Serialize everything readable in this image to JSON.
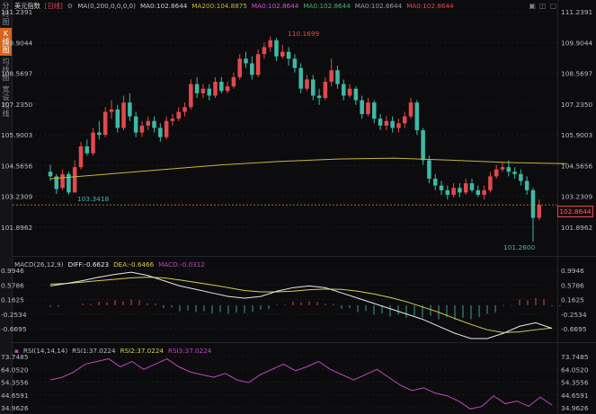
{
  "toolbar": {
    "tabs": [
      {
        "label": "分时图",
        "active": false
      },
      {
        "label": "K线图",
        "active": true
      },
      {
        "label": "均线图",
        "active": false
      },
      {
        "label": "宽设均线",
        "active": false
      }
    ]
  },
  "main_legend": {
    "symbol": "美元指数",
    "period": "[日线]",
    "ma_params": "MA(0,200,0,0,0,0)",
    "ma0": "MA0:102.8644",
    "ma200": "MA200:104.8875",
    "ma0b": "MA0:102.8644",
    "ma0c": "MA0:102.8644",
    "ma0d": "MA0:102.8644",
    "ma0e": "MA0:102.8644"
  },
  "macd_legend": {
    "name": "MACD(26,12,9)",
    "diff": "DIFF:-0.6623",
    "dea": "DEA:-0.6466",
    "macd": "MACD:-0.0312"
  },
  "rsi_legend": {
    "name": "RSI(14,14,14)",
    "rsi1": "RSI1:37.0224",
    "rsi2": "RSI2:37.0224",
    "rsi3": "RSI3:37.0224"
  },
  "colors": {
    "up": "#e2494c",
    "down": "#3fb8a4",
    "ma200": "#c9b53a",
    "dea": "#d7ce52",
    "diff": "#e8e8e8",
    "rsi": "#c046c8",
    "macd_pos": "#d94a4d",
    "macd_neg": "#3a9f8f",
    "price_line": "#e08a2a"
  },
  "icons": [
    "settings-icon",
    "refresh-icon",
    "close-icon"
  ],
  "chart_data": [
    {
      "type": "candlestick",
      "title": "美元指数 [日线]",
      "yaxis_ticks": [
        "111.2391",
        "109.9044",
        "108.5697",
        "107.2350",
        "105.9003",
        "104.5656",
        "103.2309",
        "101.8962"
      ],
      "ylim": [
        101.4,
        111.2391
      ],
      "last_price": "102.8644",
      "high_label": "110.1699",
      "low_label_1": "103.3418",
      "low_label_2": "101.2600",
      "candles": [
        [
          104.3,
          104.1,
          104.6,
          103.9
        ],
        [
          104.1,
          103.55,
          104.2,
          103.34
        ],
        [
          103.6,
          104.2,
          104.4,
          103.5
        ],
        [
          104.2,
          103.4,
          104.3,
          103.3
        ],
        [
          103.4,
          104.5,
          104.8,
          103.4
        ],
        [
          104.5,
          105.4,
          105.6,
          104.4
        ],
        [
          105.4,
          105.1,
          105.7,
          105.0
        ],
        [
          105.1,
          106.0,
          106.2,
          105.0
        ],
        [
          106.0,
          105.9,
          106.5,
          105.7
        ],
        [
          105.9,
          106.9,
          107.1,
          105.8
        ],
        [
          106.9,
          107.0,
          107.4,
          106.6
        ],
        [
          107.0,
          106.2,
          107.2,
          106.0
        ],
        [
          106.2,
          107.3,
          107.6,
          106.1
        ],
        [
          107.3,
          106.7,
          107.7,
          106.5
        ],
        [
          106.7,
          106.0,
          106.9,
          105.8
        ],
        [
          106.0,
          106.3,
          106.5,
          105.8
        ],
        [
          106.3,
          106.5,
          106.7,
          106.1
        ],
        [
          106.5,
          106.2,
          106.7,
          106.0
        ],
        [
          106.2,
          105.8,
          106.4,
          105.6
        ],
        [
          105.8,
          106.5,
          106.7,
          105.7
        ],
        [
          106.5,
          106.6,
          106.8,
          106.3
        ],
        [
          106.6,
          106.9,
          107.1,
          106.5
        ],
        [
          106.9,
          107.1,
          107.3,
          106.7
        ],
        [
          107.1,
          108.1,
          108.3,
          107.0
        ],
        [
          108.1,
          107.7,
          108.4,
          107.5
        ],
        [
          107.7,
          107.9,
          108.1,
          107.5
        ],
        [
          107.9,
          107.6,
          108.1,
          107.4
        ],
        [
          107.6,
          108.2,
          108.4,
          107.5
        ],
        [
          108.2,
          107.8,
          108.4,
          107.7
        ],
        [
          107.8,
          108.0,
          108.2,
          107.7
        ],
        [
          108.0,
          108.4,
          108.6,
          107.9
        ],
        [
          108.4,
          109.2,
          109.4,
          108.3
        ],
        [
          109.2,
          109.0,
          109.5,
          108.8
        ],
        [
          109.0,
          108.5,
          109.3,
          108.3
        ],
        [
          108.5,
          109.4,
          109.6,
          108.4
        ],
        [
          109.4,
          109.7,
          109.9,
          109.2
        ],
        [
          109.7,
          110.0,
          110.17,
          109.5
        ],
        [
          110.0,
          109.3,
          110.1,
          109.1
        ],
        [
          109.3,
          109.5,
          109.8,
          109.2
        ],
        [
          109.5,
          109.2,
          109.7,
          108.9
        ],
        [
          109.2,
          108.8,
          109.4,
          108.6
        ],
        [
          108.8,
          107.9,
          109.0,
          107.7
        ],
        [
          107.9,
          108.3,
          108.5,
          107.8
        ],
        [
          108.3,
          107.6,
          108.5,
          107.4
        ],
        [
          107.6,
          107.5,
          107.9,
          107.2
        ],
        [
          107.5,
          108.2,
          108.4,
          107.4
        ],
        [
          108.2,
          108.7,
          109.2,
          108.0
        ],
        [
          108.7,
          108.1,
          108.9,
          107.9
        ],
        [
          108.1,
          107.6,
          108.3,
          107.4
        ],
        [
          107.6,
          107.9,
          108.1,
          107.5
        ],
        [
          107.9,
          107.4,
          108.0,
          107.2
        ],
        [
          107.4,
          106.8,
          107.6,
          106.6
        ],
        [
          106.8,
          107.3,
          107.5,
          106.7
        ],
        [
          107.3,
          106.6,
          107.4,
          106.4
        ],
        [
          106.6,
          106.3,
          106.8,
          106.1
        ],
        [
          106.3,
          106.5,
          106.7,
          106.1
        ],
        [
          106.5,
          106.2,
          106.7,
          106.0
        ],
        [
          106.2,
          106.4,
          106.6,
          106.0
        ],
        [
          106.4,
          106.7,
          106.9,
          106.2
        ],
        [
          106.7,
          107.3,
          107.5,
          106.6
        ],
        [
          107.3,
          106.1,
          107.4,
          105.9
        ],
        [
          106.1,
          104.8,
          106.2,
          104.6
        ],
        [
          104.8,
          104.0,
          105.0,
          103.8
        ],
        [
          104.0,
          103.7,
          104.2,
          103.5
        ],
        [
          103.7,
          103.5,
          103.9,
          103.3
        ],
        [
          103.5,
          103.3,
          103.7,
          103.1
        ],
        [
          103.3,
          103.6,
          103.8,
          103.2
        ],
        [
          103.6,
          103.4,
          103.8,
          103.2
        ],
        [
          103.4,
          103.8,
          104.0,
          103.3
        ],
        [
          103.8,
          103.5,
          104.0,
          103.4
        ],
        [
          103.5,
          103.3,
          103.7,
          103.2
        ],
        [
          103.3,
          103.5,
          103.7,
          103.1
        ],
        [
          103.5,
          104.1,
          104.3,
          103.4
        ],
        [
          104.1,
          104.4,
          104.6,
          104.0
        ],
        [
          104.4,
          104.5,
          104.7,
          104.3
        ],
        [
          104.5,
          104.3,
          104.8,
          104.1
        ],
        [
          104.3,
          104.2,
          104.5,
          104.0
        ],
        [
          104.2,
          103.9,
          104.4,
          103.7
        ],
        [
          103.9,
          103.5,
          104.1,
          103.3
        ],
        [
          103.5,
          102.3,
          103.6,
          101.26
        ],
        [
          102.3,
          102.86,
          103.1,
          102.2
        ]
      ],
      "ma200": [
        104.0,
        104.2,
        104.4,
        104.6,
        104.75,
        104.85,
        104.89,
        104.8,
        104.7,
        104.65
      ]
    },
    {
      "type": "macd",
      "yaxis_ticks": [
        "0.9946",
        "0.5786",
        "0.1625",
        "-0.2534",
        "-0.6695"
      ],
      "ylim": [
        -0.95,
        1.05
      ],
      "diff": [
        0.55,
        0.62,
        0.7,
        0.8,
        0.88,
        0.94,
        0.85,
        0.7,
        0.55,
        0.45,
        0.35,
        0.25,
        0.2,
        0.25,
        0.4,
        0.5,
        0.55,
        0.5,
        0.35,
        0.2,
        0.05,
        -0.1,
        -0.25,
        -0.4,
        -0.6,
        -0.8,
        -0.95,
        -0.95,
        -0.8,
        -0.6,
        -0.5,
        -0.66
      ],
      "dea": [
        0.6,
        0.62,
        0.66,
        0.7,
        0.74,
        0.78,
        0.8,
        0.78,
        0.72,
        0.65,
        0.58,
        0.5,
        0.42,
        0.38,
        0.38,
        0.4,
        0.44,
        0.46,
        0.45,
        0.4,
        0.32,
        0.22,
        0.1,
        -0.05,
        -0.2,
        -0.38,
        -0.55,
        -0.7,
        -0.78,
        -0.76,
        -0.7,
        -0.65
      ],
      "hist": [
        -0.05,
        0.0,
        0.04,
        0.1,
        0.14,
        0.16,
        0.05,
        -0.08,
        -0.17,
        -0.2,
        -0.23,
        -0.25,
        -0.22,
        -0.13,
        0.02,
        0.1,
        0.11,
        0.04,
        -0.1,
        -0.2,
        -0.27,
        -0.32,
        -0.35,
        -0.35,
        -0.4,
        -0.42,
        -0.4,
        -0.25,
        -0.02,
        0.16,
        0.2,
        -0.03
      ]
    },
    {
      "type": "line",
      "yaxis_ticks": [
        "73.7485",
        "64.0520",
        "54.3556",
        "44.6591",
        "34.9626"
      ],
      "ylim": [
        33,
        76
      ],
      "values": [
        56,
        58,
        62,
        68,
        70,
        72,
        66,
        70,
        64,
        68,
        72,
        66,
        62,
        60,
        58,
        61,
        56,
        54,
        60,
        64,
        68,
        63,
        66,
        70,
        64,
        60,
        56,
        60,
        64,
        58,
        52,
        48,
        50,
        46,
        44,
        40,
        34,
        36,
        44,
        38,
        40,
        36,
        43,
        37
      ]
    }
  ]
}
